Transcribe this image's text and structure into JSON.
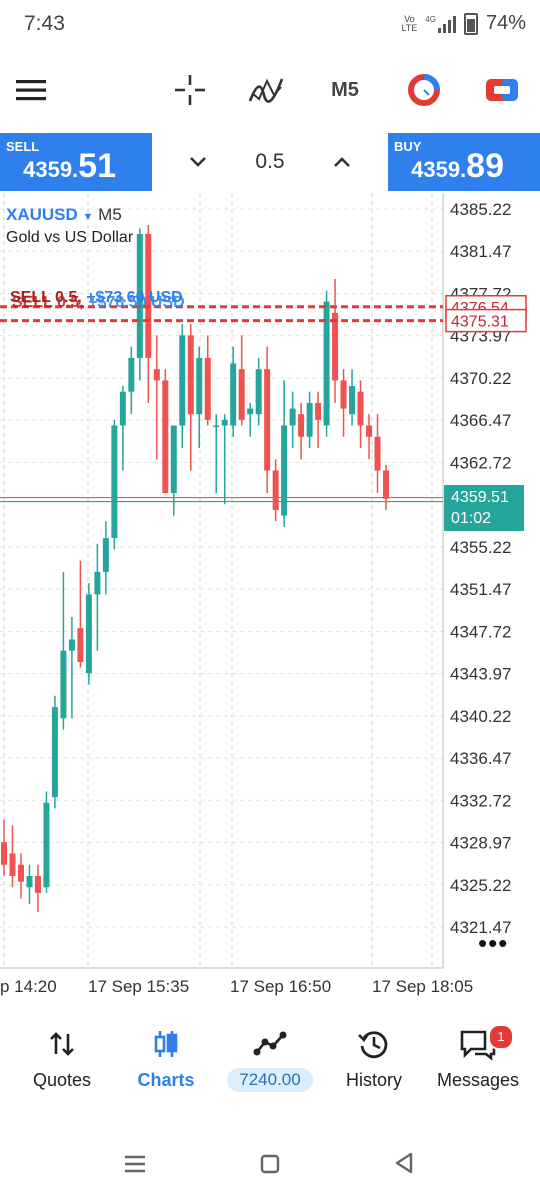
{
  "status_bar": {
    "time": "7:43",
    "network": "4G",
    "carrier_top": "Vo",
    "carrier_bottom": "LTE",
    "battery": "74%"
  },
  "toolbar": {
    "timeframe": "M5",
    "icons": [
      "menu-icon",
      "crosshair-icon",
      "indicators-icon",
      "timeframe-button",
      "chart-style-icon",
      "one-click-trading-icon"
    ]
  },
  "trade": {
    "sell_label": "SELL",
    "sell_price_small": "4359.",
    "sell_price_big": "51",
    "buy_label": "BUY",
    "buy_price_small": "4359.",
    "buy_price_big": "89",
    "volume": "0.5"
  },
  "chart_info": {
    "symbol": "XAUUSD",
    "timeframe": "M5",
    "description": "Gold vs US Dollar"
  },
  "orders": [
    {
      "label": "SELL 0.5,",
      "profit": "+$73.60 USD"
    },
    {
      "label": "SELL 0.5,",
      "profit": "+$78.50 USD"
    }
  ],
  "price_axis": [
    "4385.22",
    "4381.47",
    "4377.72",
    "4373.97",
    "4370.22",
    "4366.47",
    "4362.72",
    "4355.22",
    "4351.47",
    "4347.72",
    "4343.97",
    "4340.22",
    "4336.47",
    "4332.72",
    "4328.97",
    "4325.22",
    "4321.47"
  ],
  "order_line_prices": [
    "4376.54",
    "4375.31"
  ],
  "current_price": {
    "price": "4359.51",
    "timer": "01:02"
  },
  "time_axis": [
    "p 14:20",
    "17 Sep 15:35",
    "17 Sep 16:50",
    "17 Sep 18:05"
  ],
  "colors": {
    "bull": "#26a69a",
    "bear": "#ef5350",
    "accent": "#2f80ed"
  },
  "chart_data": {
    "type": "candlestick",
    "ylim": [
      4319.5,
      4387.2
    ],
    "candles": [
      {
        "o": 4329,
        "h": 4331,
        "l": 4326,
        "c": 4327
      },
      {
        "o": 4328,
        "h": 4330.5,
        "l": 4325,
        "c": 4326
      },
      {
        "o": 4327,
        "h": 4328,
        "l": 4324,
        "c": 4325.5
      },
      {
        "o": 4325,
        "h": 4327,
        "l": 4323.5,
        "c": 4326
      },
      {
        "o": 4326,
        "h": 4327,
        "l": 4322.8,
        "c": 4324.5
      },
      {
        "o": 4325,
        "h": 4333.5,
        "l": 4324.5,
        "c": 4332.5
      },
      {
        "o": 4333,
        "h": 4342,
        "l": 4332,
        "c": 4341
      },
      {
        "o": 4340,
        "h": 4353,
        "l": 4339,
        "c": 4346
      },
      {
        "o": 4346,
        "h": 4349,
        "l": 4340,
        "c": 4347
      },
      {
        "o": 4348,
        "h": 4354,
        "l": 4344.5,
        "c": 4345
      },
      {
        "o": 4344,
        "h": 4352,
        "l": 4343,
        "c": 4351
      },
      {
        "o": 4351,
        "h": 4355.5,
        "l": 4346,
        "c": 4353
      },
      {
        "o": 4353,
        "h": 4357.5,
        "l": 4351,
        "c": 4356
      },
      {
        "o": 4356,
        "h": 4366.5,
        "l": 4355,
        "c": 4366
      },
      {
        "o": 4366,
        "h": 4369.5,
        "l": 4362,
        "c": 4369
      },
      {
        "o": 4369,
        "h": 4373,
        "l": 4367,
        "c": 4372
      },
      {
        "o": 4372,
        "h": 4383.5,
        "l": 4370,
        "c": 4383
      },
      {
        "o": 4383,
        "h": 4383.8,
        "l": 4368,
        "c": 4372
      },
      {
        "o": 4371,
        "h": 4374,
        "l": 4363,
        "c": 4370
      },
      {
        "o": 4370,
        "h": 4371,
        "l": 4360,
        "c": 4360
      },
      {
        "o": 4360,
        "h": 4365,
        "l": 4358,
        "c": 4366
      },
      {
        "o": 4366,
        "h": 4375,
        "l": 4364,
        "c": 4374
      },
      {
        "o": 4374,
        "h": 4375,
        "l": 4362,
        "c": 4367
      },
      {
        "o": 4367,
        "h": 4373,
        "l": 4364,
        "c": 4372
      },
      {
        "o": 4372,
        "h": 4374,
        "l": 4366,
        "c": 4366.5
      },
      {
        "o": 4366,
        "h": 4367,
        "l": 4360,
        "c": 4366
      },
      {
        "o": 4366,
        "h": 4367,
        "l": 4359,
        "c": 4366.5
      },
      {
        "o": 4366,
        "h": 4373,
        "l": 4365,
        "c": 4371.5
      },
      {
        "o": 4371,
        "h": 4374,
        "l": 4366,
        "c": 4366.5
      },
      {
        "o": 4367,
        "h": 4368,
        "l": 4365,
        "c": 4367.5
      },
      {
        "o": 4367,
        "h": 4372,
        "l": 4366,
        "c": 4371
      },
      {
        "o": 4371,
        "h": 4373,
        "l": 4360,
        "c": 4362
      },
      {
        "o": 4362,
        "h": 4363,
        "l": 4357.5,
        "c": 4358.5
      },
      {
        "o": 4358,
        "h": 4370,
        "l": 4357,
        "c": 4366
      },
      {
        "o": 4366,
        "h": 4369,
        "l": 4364,
        "c": 4367.5
      },
      {
        "o": 4367,
        "h": 4368,
        "l": 4363,
        "c": 4365
      },
      {
        "o": 4365,
        "h": 4369,
        "l": 4364,
        "c": 4368
      },
      {
        "o": 4368,
        "h": 4369,
        "l": 4364,
        "c": 4366.5
      },
      {
        "o": 4366,
        "h": 4378,
        "l": 4365,
        "c": 4377
      },
      {
        "o": 4376,
        "h": 4379,
        "l": 4368,
        "c": 4370
      },
      {
        "o": 4370,
        "h": 4371,
        "l": 4365,
        "c": 4367.5
      },
      {
        "o": 4367,
        "h": 4371,
        "l": 4366,
        "c": 4369.5
      },
      {
        "o": 4369,
        "h": 4370,
        "l": 4364,
        "c": 4366
      },
      {
        "o": 4366,
        "h": 4367,
        "l": 4363,
        "c": 4365
      },
      {
        "o": 4365,
        "h": 4367,
        "l": 4360,
        "c": 4362
      },
      {
        "o": 4362,
        "h": 4362.5,
        "l": 4358.5,
        "c": 4359.5
      }
    ]
  },
  "bottom_nav": {
    "quotes": "Quotes",
    "charts": "Charts",
    "trade": "7240.00",
    "history": "History",
    "messages": "Messages",
    "messages_badge": "1"
  }
}
